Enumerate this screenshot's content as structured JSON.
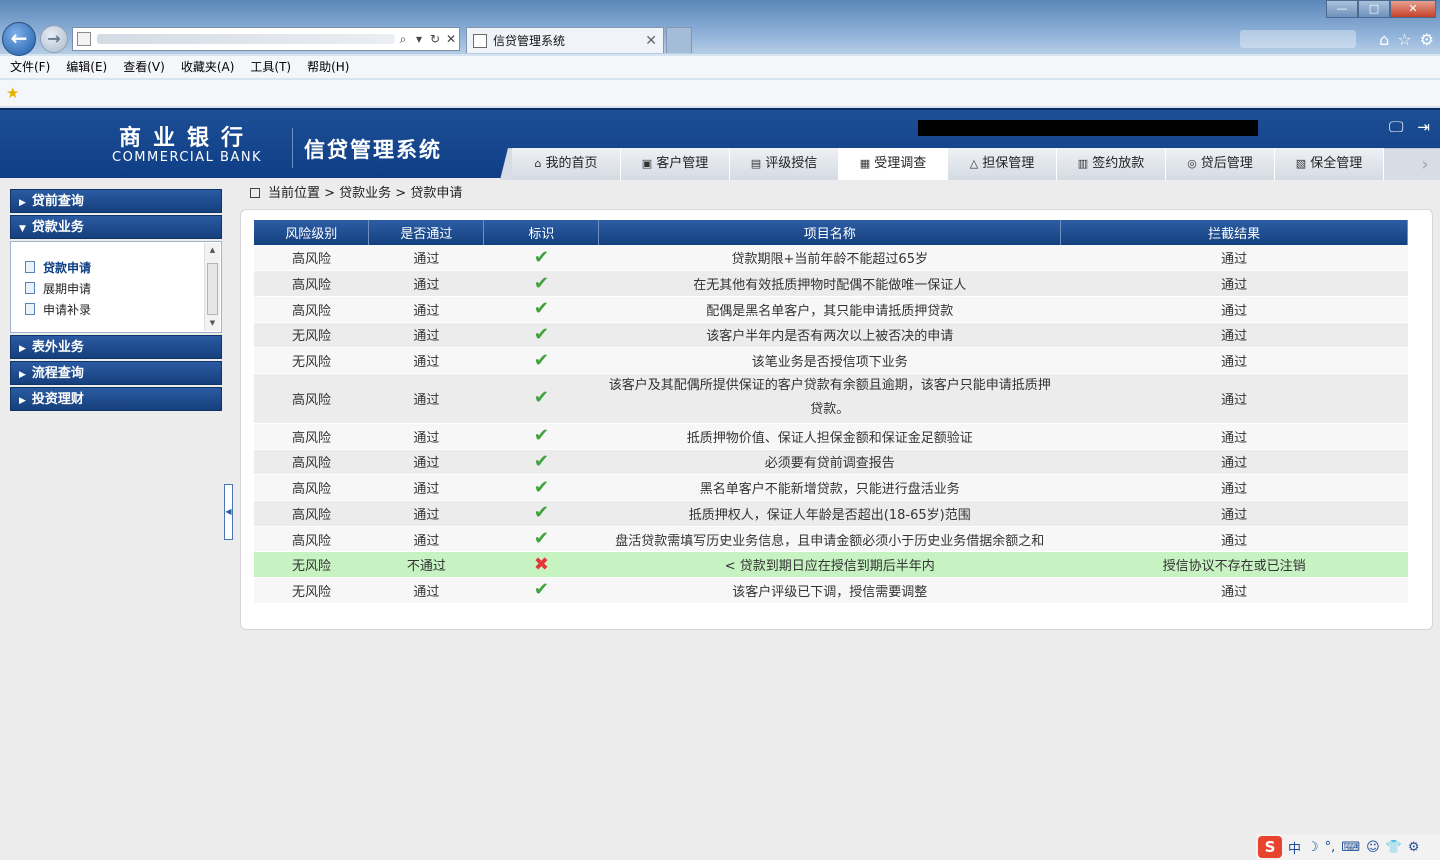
{
  "browser": {
    "tab_title": "信贷管理系统",
    "tab_close": "✕",
    "back": "←",
    "forward": "→",
    "addr_icons": [
      "⌕",
      "▾",
      "↻",
      "✕"
    ],
    "window": {
      "min": "—",
      "max": "□",
      "close": "✕"
    },
    "right_icons": [
      "⌂",
      "☆",
      "⚙"
    ],
    "menu": [
      "文件(F)",
      "编辑(E)",
      "查看(V)",
      "收藏夹(A)",
      "工具(T)",
      "帮助(H)"
    ],
    "fav_star": "★"
  },
  "header": {
    "bank_cn": "商业银行",
    "bank_en": "COMMERCIAL BANK",
    "system_name": "信贷管理系统",
    "icons": [
      "🖵",
      "⇥"
    ],
    "nav_more": "›",
    "nav": [
      {
        "label": "我的首页",
        "icon": "⌂"
      },
      {
        "label": "客户管理",
        "icon": "▣"
      },
      {
        "label": "评级授信",
        "icon": "▤"
      },
      {
        "label": "受理调查",
        "icon": "▦"
      },
      {
        "label": "担保管理",
        "icon": "△"
      },
      {
        "label": "签约放款",
        "icon": "▥"
      },
      {
        "label": "贷后管理",
        "icon": "◎"
      },
      {
        "label": "保全管理",
        "icon": "▧"
      }
    ],
    "active_nav": 3
  },
  "sidebar": {
    "sections": [
      {
        "label": "贷前查询",
        "tri": "▶"
      },
      {
        "label": "贷款业务",
        "tri": "▼"
      },
      {
        "label": "表外业务",
        "tri": "▶"
      },
      {
        "label": "流程查询",
        "tri": "▶"
      },
      {
        "label": "投资理财",
        "tri": "▶"
      }
    ],
    "sub_items": [
      "贷款申请",
      "展期申请",
      "申请补录"
    ],
    "scroll_up": "▲",
    "scroll_down": "▼",
    "splitter": "◀"
  },
  "breadcrumb": "当前位置 > 贷款业务 > 贷款申请",
  "table": {
    "headers": [
      "风险级别",
      "是否通过",
      "标识",
      "项目名称",
      "拦截结果"
    ],
    "rows": [
      {
        "risk": "高风险",
        "pass": "通过",
        "mark": "✔",
        "name": "贷款期限+当前年龄不能超过65岁",
        "result": "通过"
      },
      {
        "risk": "高风险",
        "pass": "通过",
        "mark": "✔",
        "name": "在无其他有效抵质押物时配偶不能做唯一保证人",
        "result": "通过"
      },
      {
        "risk": "高风险",
        "pass": "通过",
        "mark": "✔",
        "name": "配偶是黑名单客户，其只能申请抵质押贷款",
        "result": "通过"
      },
      {
        "risk": "无风险",
        "pass": "通过",
        "mark": "✔",
        "name": "该客户半年内是否有两次以上被否决的申请",
        "result": "通过"
      },
      {
        "risk": "无风险",
        "pass": "通过",
        "mark": "✔",
        "name": "该笔业务是否授信项下业务",
        "result": "通过"
      },
      {
        "risk": "高风险",
        "pass": "通过",
        "mark": "✔",
        "name_line1": "该客户及其配偶所提供保证的客户贷款有余额且逾期，该客户只能申请抵质押",
        "name_line2": "贷款。",
        "result": "通过"
      },
      {
        "risk": "高风险",
        "pass": "通过",
        "mark": "✔",
        "name": "抵质押物价值、保证人担保金额和保证金足额验证",
        "result": "通过"
      },
      {
        "risk": "高风险",
        "pass": "通过",
        "mark": "✔",
        "name": "必须要有贷前调查报告",
        "result": "通过"
      },
      {
        "risk": "高风险",
        "pass": "通过",
        "mark": "✔",
        "name": "黑名单客户不能新增贷款，只能进行盘活业务",
        "result": "通过"
      },
      {
        "risk": "高风险",
        "pass": "通过",
        "mark": "✔",
        "name": "抵质押权人，保证人年龄是否超出(18-65岁)范围",
        "result": "通过"
      },
      {
        "risk": "高风险",
        "pass": "通过",
        "mark": "✔",
        "name": "盘活贷款需填写历史业务信息，且申请金额必须小于历史业务借据余额之和",
        "result": "通过"
      },
      {
        "risk": "无风险",
        "pass": "不通过",
        "mark": "✖",
        "name": "< 贷款到期日应在授信到期后半年内",
        "result": "授信协议不存在或已注销"
      },
      {
        "risk": "无风险",
        "pass": "通过",
        "mark": "✔",
        "name": "该客户评级已下调，授信需要调整",
        "result": "通过"
      }
    ]
  },
  "ime": {
    "logo": "S",
    "lang": "中",
    "icons": [
      "☽",
      "°,",
      "⌨",
      "☺",
      "👕",
      "⚙"
    ]
  },
  "colors": {
    "header_blue": "#0f3e85",
    "pass_green": "#3fa33a",
    "fail_red": "#e43737",
    "highlight_row": "#c7f2c2"
  }
}
